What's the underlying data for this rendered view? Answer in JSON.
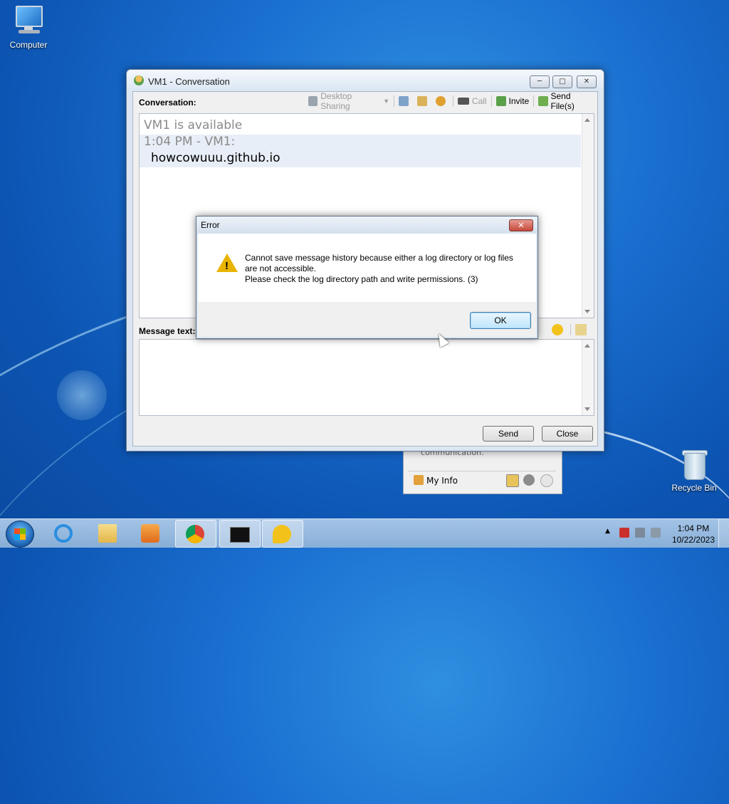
{
  "desktop": {
    "icons": [
      {
        "label": "Computer"
      },
      {
        "label": "Recycle Bin"
      }
    ]
  },
  "behind_window": {
    "message": "communication.",
    "my_info_label": "My Info"
  },
  "conversation_window": {
    "title": "VM1 - Conversation",
    "conversation_label": "Conversation:",
    "toolbar": {
      "desktop_sharing": "Desktop Sharing",
      "call": "Call",
      "invite": "Invite",
      "send_files": "Send File(s)"
    },
    "messages": {
      "status": "VM1 is available",
      "header": "1:04 PM - VM1:",
      "body": "howcowuuu.github.io"
    },
    "message_text_label": "Message text:",
    "buttons": {
      "send": "Send",
      "close": "Close"
    }
  },
  "error_dialog": {
    "title": "Error",
    "line1": "Cannot save message history because either a log directory or log files",
    "line2": "are not accessible.",
    "line3": "Please check the log directory path and write permissions. (3)",
    "ok": "OK"
  },
  "taskbar": {
    "time": "1:04 PM",
    "date": "10/22/2023"
  },
  "colors": {
    "desktop_bg": "#1a6fd0",
    "warning": "#e8b400",
    "close_button": "#c4483b"
  }
}
